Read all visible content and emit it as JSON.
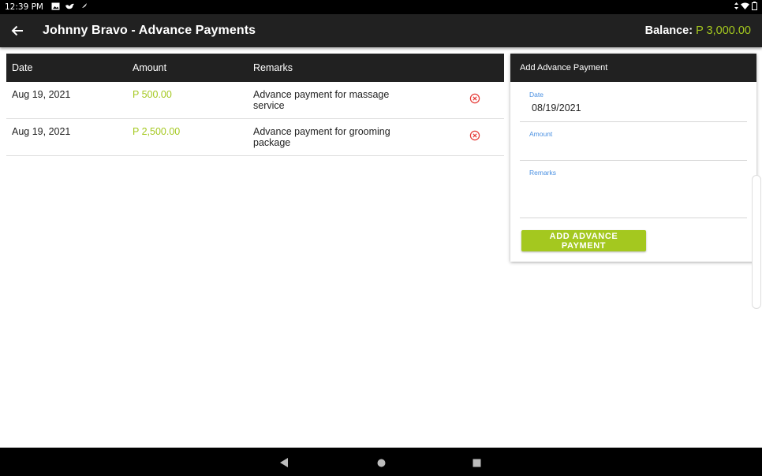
{
  "status_bar": {
    "time": "12:39 PM",
    "icons": [
      "image-icon",
      "bird-icon",
      "feather-icon"
    ],
    "right_icons": [
      "data-arrows-icon",
      "wifi-icon",
      "battery-icon"
    ]
  },
  "app_bar": {
    "title": "Johnny Bravo - Advance Payments",
    "balance_label": "Balance:",
    "balance_value": "P 3,000.00"
  },
  "table": {
    "headers": {
      "date": "Date",
      "amount": "Amount",
      "remarks": "Remarks"
    },
    "rows": [
      {
        "date": "Aug 19, 2021",
        "amount": "P 500.00",
        "remarks": "Advance payment for massage service"
      },
      {
        "date": "Aug 19, 2021",
        "amount": "P 2,500.00",
        "remarks": "Advance payment for grooming package"
      }
    ]
  },
  "form": {
    "title": "Add Advance Payment",
    "date_label": "Date",
    "date_value": "08/19/2021",
    "amount_label": "Amount",
    "remarks_label": "Remarks",
    "submit_label": "ADD ADVANCE PAYMENT"
  },
  "colors": {
    "accent": "#a4c81f",
    "header_bg": "#212121",
    "label_blue": "#4a90e2",
    "delete_red": "#e53935"
  }
}
